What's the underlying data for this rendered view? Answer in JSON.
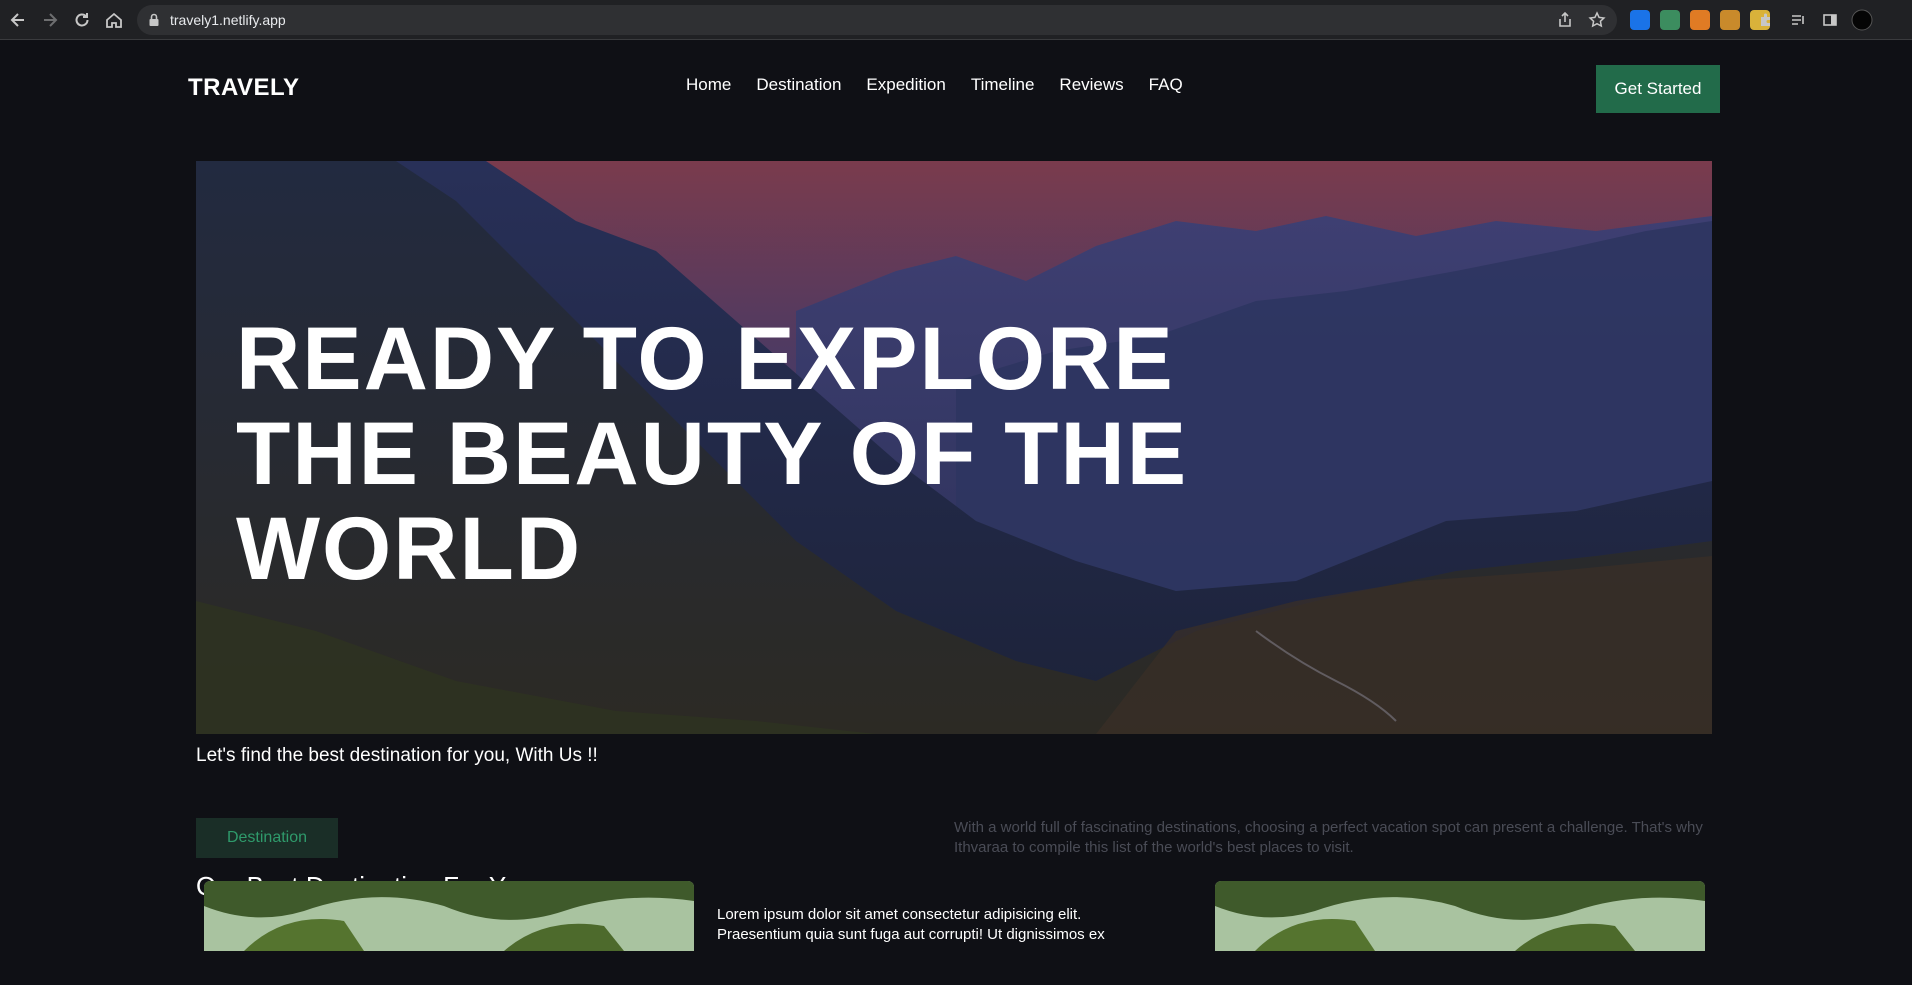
{
  "browser": {
    "url": "travely1.netlify.app"
  },
  "header": {
    "brand": "TRAVELY",
    "nav": [
      "Home",
      "Destination",
      "Expedition",
      "Timeline",
      "Reviews",
      "FAQ"
    ],
    "cta_label": "Get Started"
  },
  "hero": {
    "title_line1": "READY TO EXPLORE",
    "title_line2": "THE BEAUTY OF THE",
    "title_line3": "WORLD",
    "tagline": "Let's find the best destination for you, With Us !!"
  },
  "destination": {
    "badge": "Destination",
    "description": "With a world full of fascinating destinations, choosing a perfect vacation spot can present a challenge. That's why Ithvaraa to compile this list of the world's best places to visit.",
    "title": "Our Best Destination For You",
    "card_text_line1": "Lorem ipsum dolor sit amet consectetur adipisicing elit.",
    "card_text_line2": "Praesentium quia sunt fuga aut corrupti! Ut dignissimos ex"
  },
  "colors": {
    "accent": "#226b4a",
    "background": "#0f1015",
    "badge_text": "#2f9a6b"
  }
}
